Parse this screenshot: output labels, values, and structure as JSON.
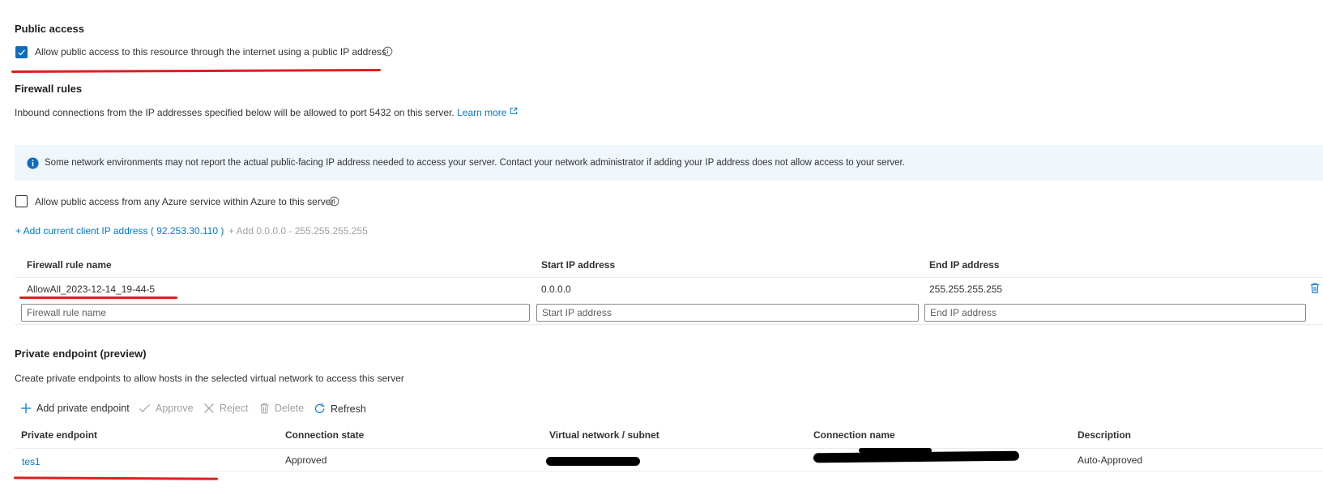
{
  "public_access": {
    "heading": "Public access",
    "checkbox_label": "Allow public access to this resource through the internet using a public IP address",
    "checked": true
  },
  "firewall": {
    "heading": "Firewall rules",
    "description": "Inbound connections from the IP addresses specified below will be allowed to port 5432 on this server.",
    "learn_more": "Learn more",
    "banner_text": "Some network environments may not report the actual public-facing IP address needed to access your server.  Contact your network administrator if adding your IP address does not allow access to your server.",
    "azure_checkbox_label": "Allow public access from any Azure service within Azure to this server",
    "azure_checked": false,
    "add_client_ip": "+ Add current client IP address ( 92.253.30.110 )",
    "add_all": "+ Add 0.0.0.0 - 255.255.255.255",
    "columns": {
      "name": "Firewall rule name",
      "start": "Start IP address",
      "end": "End IP address"
    },
    "rows": [
      {
        "name": "AllowAll_2023-12-14_19-44-5",
        "start": "0.0.0.0",
        "end": "255.255.255.255"
      }
    ],
    "new_row_placeholders": {
      "name": "Firewall rule name",
      "start": "Start IP address",
      "end": "End IP address"
    }
  },
  "private_endpoint": {
    "heading": "Private endpoint (preview)",
    "description": "Create private endpoints to allow hosts in the selected virtual network to access this server",
    "toolbar": {
      "add": "Add private endpoint",
      "approve": "Approve",
      "reject": "Reject",
      "delete": "Delete",
      "refresh": "Refresh"
    },
    "columns": {
      "endpoint": "Private endpoint",
      "state": "Connection state",
      "vnet": "Virtual network / subnet",
      "conn_name": "Connection name",
      "description": "Description"
    },
    "rows": [
      {
        "endpoint": "tes1",
        "state": "Approved",
        "description": "Auto-Approved"
      }
    ]
  },
  "colors": {
    "accent": "#0078d4",
    "banner_bg": "#eff6fc",
    "annotation_red": "#e01e1e"
  },
  "icons": [
    "checkmark-icon",
    "info-icon",
    "external-link-icon",
    "info-filled-icon",
    "trash-icon",
    "plus-icon",
    "check-icon",
    "x-icon",
    "delete-icon",
    "refresh-icon"
  ]
}
